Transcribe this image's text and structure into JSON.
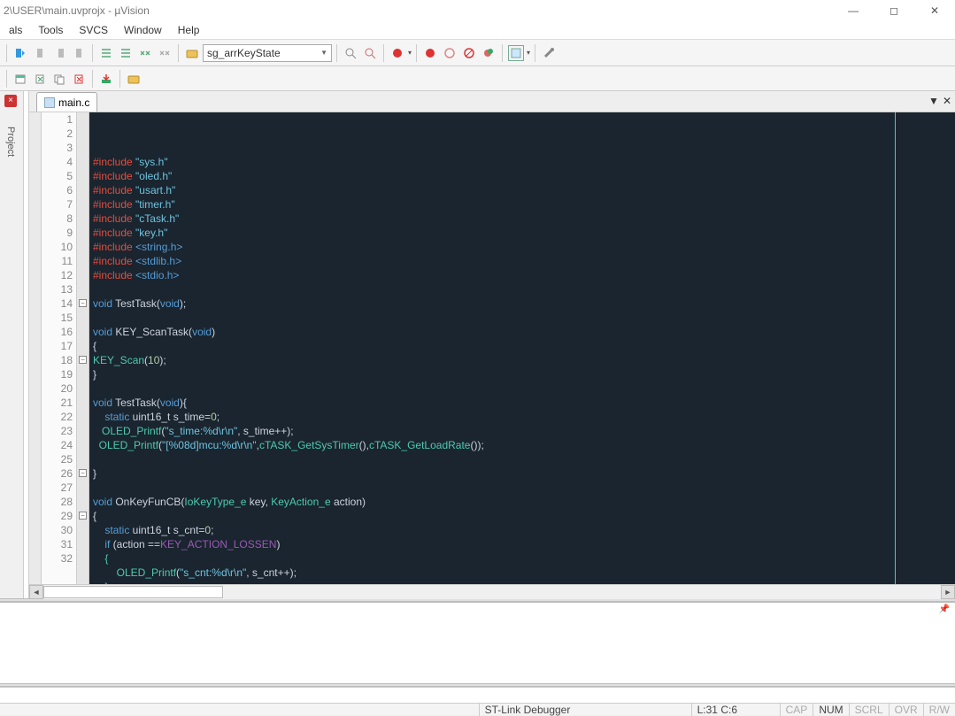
{
  "window": {
    "title": "2\\USER\\main.uvprojx - µVision",
    "minimize": "—",
    "maximize": "◻",
    "close": "✕"
  },
  "menubar": {
    "items": [
      "als",
      "Tools",
      "SVCS",
      "Window",
      "Help"
    ]
  },
  "toolbar": {
    "combo_value": "sg_arrKeyState"
  },
  "tab": {
    "filename": "main.c",
    "nav_down": "▼",
    "nav_x": "✕"
  },
  "code": {
    "lines": [
      [
        {
          "t": "#include ",
          "c": "kw-pp"
        },
        {
          "t": "\"sys.h\"",
          "c": "str"
        }
      ],
      [
        {
          "t": "#include ",
          "c": "kw-pp"
        },
        {
          "t": "\"oled.h\"",
          "c": "str"
        }
      ],
      [
        {
          "t": "#include ",
          "c": "kw-pp"
        },
        {
          "t": "\"usart.h\"",
          "c": "str"
        }
      ],
      [
        {
          "t": "#include ",
          "c": "kw-pp"
        },
        {
          "t": "\"timer.h\"",
          "c": "str"
        }
      ],
      [
        {
          "t": "#include ",
          "c": "kw-pp"
        },
        {
          "t": "\"cTask.h\"",
          "c": "str"
        }
      ],
      [
        {
          "t": "#include ",
          "c": "kw-pp"
        },
        {
          "t": "\"key.h\"",
          "c": "str"
        }
      ],
      [
        {
          "t": "#include ",
          "c": "kw-pp"
        },
        {
          "t": "<string.h>",
          "c": "kw-type"
        }
      ],
      [
        {
          "t": "#include ",
          "c": "kw-pp"
        },
        {
          "t": "<stdlib.h>",
          "c": "kw-type"
        }
      ],
      [
        {
          "t": "#include ",
          "c": "kw-pp"
        },
        {
          "t": "<stdio.h>",
          "c": "kw-type"
        }
      ],
      [
        {
          "t": "",
          "c": ""
        }
      ],
      [
        {
          "t": "void",
          "c": "kw-type"
        },
        {
          "t": " TestTask(",
          "c": "ident"
        },
        {
          "t": "void",
          "c": "kw-type"
        },
        {
          "t": ");",
          "c": "ident"
        }
      ],
      [
        {
          "t": "",
          "c": ""
        }
      ],
      [
        {
          "t": "void",
          "c": "kw-type"
        },
        {
          "t": " KEY_ScanTask(",
          "c": "ident"
        },
        {
          "t": "void",
          "c": "kw-type"
        },
        {
          "t": ")",
          "c": "ident"
        }
      ],
      [
        {
          "t": "{",
          "c": "ident"
        }
      ],
      [
        {
          "t": "KEY_Scan",
          "c": "fn"
        },
        {
          "t": "(",
          "c": "ident"
        },
        {
          "t": "10",
          "c": "num"
        },
        {
          "t": ");",
          "c": "ident"
        }
      ],
      [
        {
          "t": "}",
          "c": "ident"
        }
      ],
      [
        {
          "t": "",
          "c": ""
        }
      ],
      [
        {
          "t": "void",
          "c": "kw-type"
        },
        {
          "t": " TestTask(",
          "c": "ident"
        },
        {
          "t": "void",
          "c": "kw-type"
        },
        {
          "t": "){",
          "c": "ident"
        }
      ],
      [
        {
          "t": "    static",
          "c": "kw-type"
        },
        {
          "t": " uint16_t s_time=",
          "c": "ident"
        },
        {
          "t": "0",
          "c": "num"
        },
        {
          "t": ";",
          "c": "ident"
        }
      ],
      [
        {
          "t": "   OLED_Printf",
          "c": "fn"
        },
        {
          "t": "(",
          "c": "ident"
        },
        {
          "t": "\"s_time:%d\\r\\n\"",
          "c": "str"
        },
        {
          "t": ", s_time++);",
          "c": "ident"
        }
      ],
      [
        {
          "t": "  OLED_Printf",
          "c": "fn"
        },
        {
          "t": "(",
          "c": "ident"
        },
        {
          "t": "\"[%08d]mcu:%d\\r\\n\"",
          "c": "str"
        },
        {
          "t": ",",
          "c": "ident"
        },
        {
          "t": "cTASK_GetSysTimer",
          "c": "fn"
        },
        {
          "t": "(),",
          "c": "ident"
        },
        {
          "t": "cTASK_GetLoadRate",
          "c": "fn"
        },
        {
          "t": "());",
          "c": "ident"
        }
      ],
      [
        {
          "t": "",
          "c": ""
        }
      ],
      [
        {
          "t": "}",
          "c": "ident"
        }
      ],
      [
        {
          "t": "",
          "c": ""
        }
      ],
      [
        {
          "t": "void",
          "c": "kw-type"
        },
        {
          "t": " OnKeyFunCB(",
          "c": "ident"
        },
        {
          "t": "IoKeyType_e",
          "c": "fn"
        },
        {
          "t": " key, ",
          "c": "ident"
        },
        {
          "t": "KeyAction_e",
          "c": "fn"
        },
        {
          "t": " action)",
          "c": "ident"
        }
      ],
      [
        {
          "t": "{",
          "c": "ident"
        }
      ],
      [
        {
          "t": "    static",
          "c": "kw-type"
        },
        {
          "t": " uint16_t s_cnt=",
          "c": "ident"
        },
        {
          "t": "0",
          "c": "num"
        },
        {
          "t": ";",
          "c": "ident"
        }
      ],
      [
        {
          "t": "    if",
          "c": "kw-type"
        },
        {
          "t": " (action ==",
          "c": "ident"
        },
        {
          "t": "KEY_ACTION_LOSSEN",
          "c": "const"
        },
        {
          "t": ")",
          "c": "ident"
        }
      ],
      [
        {
          "t": "    {",
          "c": "fn"
        }
      ],
      [
        {
          "t": "        OLED_Printf",
          "c": "fn"
        },
        {
          "t": "(",
          "c": "ident"
        },
        {
          "t": "\"s_cnt:%d\\r\\n\"",
          "c": "str"
        },
        {
          "t": ", s_cnt++);",
          "c": "ident"
        }
      ],
      [
        {
          "t": "    }",
          "c": "fn"
        }
      ],
      [
        {
          "t": "}",
          "c": "ident"
        }
      ]
    ],
    "fold_marks": [
      {
        "line": 14,
        "sym": "−"
      },
      {
        "line": 18,
        "sym": "−"
      },
      {
        "line": 26,
        "sym": "−"
      },
      {
        "line": 29,
        "sym": "−"
      }
    ]
  },
  "statusbar": {
    "debugger": "ST-Link Debugger",
    "pos": "L:31 C:6",
    "cap": "CAP",
    "num": "NUM",
    "scrl": "SCRL",
    "ovr": "OVR",
    "rw": "R/W"
  },
  "project_pane": {
    "label": "Project"
  }
}
